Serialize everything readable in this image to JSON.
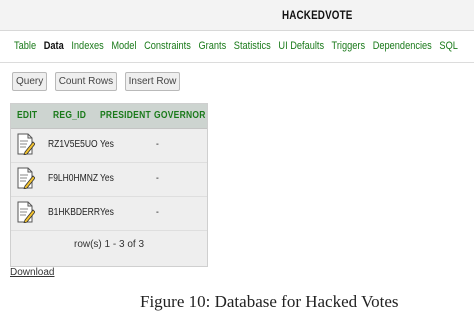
{
  "header": {
    "title": "HACKEDVOTE"
  },
  "tabs": [
    {
      "label": "Table"
    },
    {
      "label": "Data",
      "active": true
    },
    {
      "label": "Indexes"
    },
    {
      "label": "Model"
    },
    {
      "label": "Constraints"
    },
    {
      "label": "Grants"
    },
    {
      "label": "Statistics"
    },
    {
      "label": "UI Defaults"
    },
    {
      "label": "Triggers"
    },
    {
      "label": "Dependencies"
    },
    {
      "label": "SQL"
    }
  ],
  "buttons": {
    "query": "Query",
    "count_rows": "Count Rows",
    "insert_row": "Insert Row"
  },
  "grid": {
    "columns": [
      "EDIT",
      "REG_ID",
      "PRESIDENT",
      "GOVERNOR"
    ],
    "rows": [
      {
        "reg_id": "RZ1V5E5UO",
        "president": "Yes",
        "governor": "-"
      },
      {
        "reg_id": "F9LH0HMNZ",
        "president": "Yes",
        "governor": "-"
      },
      {
        "reg_id": "B1HKBDERR",
        "president": "Yes",
        "governor": "-"
      }
    ],
    "row_count": "row(s) 1 - 3 of 3"
  },
  "download_link": "Download",
  "caption": "Figure 10: Database for Hacked Votes",
  "colors": {
    "tab_link": "#1a7a1a",
    "header_bg": "#cdd4d0"
  },
  "icons": {
    "edit": "edit-icon"
  }
}
